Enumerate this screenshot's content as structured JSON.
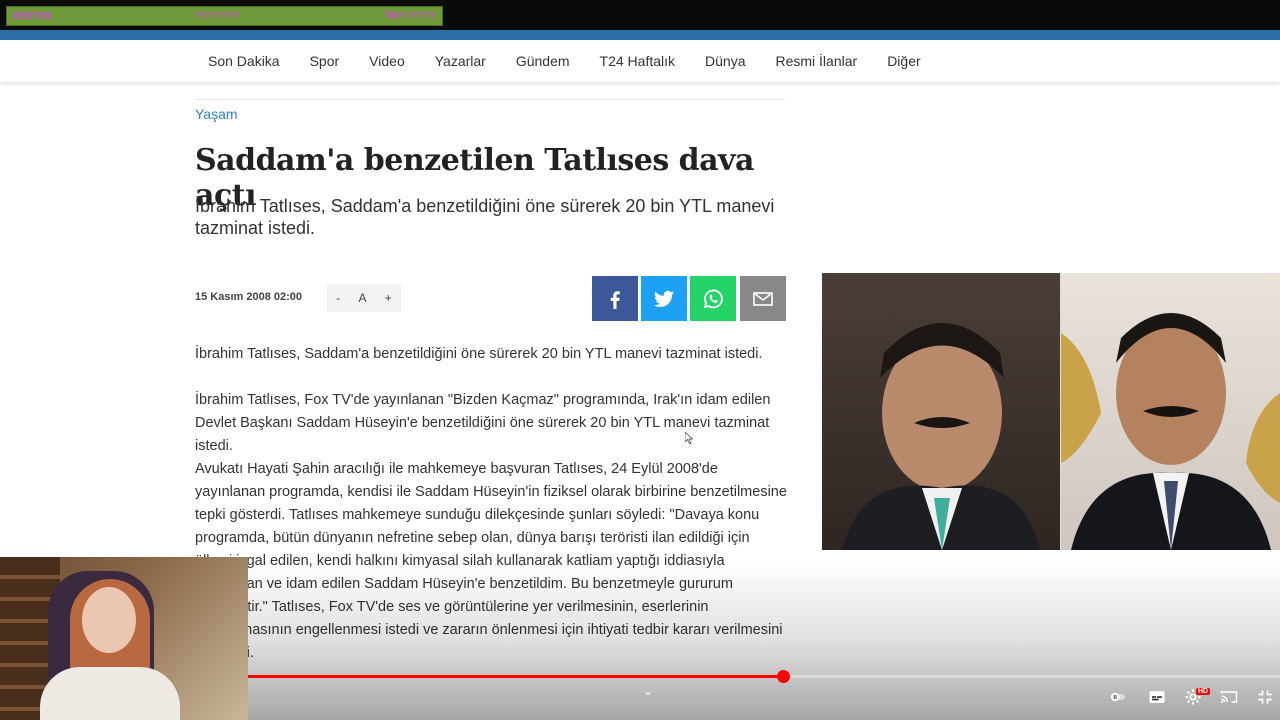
{
  "donation_bar": {
    "left_label": "DEBTEK",
    "mid_label": "???????",
    "right_label": "TRY?????"
  },
  "nav": {
    "items": [
      "Son Dakika",
      "Spor",
      "Video",
      "Yazarlar",
      "Gündem",
      "T24 Haftalık",
      "Dünya",
      "Resmi İlanlar",
      "Diğer"
    ]
  },
  "article": {
    "category": "Yaşam",
    "headline": "Saddam'a benzetilen Tatlıses dava açtı",
    "subhead": "İbrahim Tatlıses, Saddam'a benzetildiğini öne sürerek 20 bin YTL manevi tazminat istedi.",
    "date": "15 Kasım 2008 02:00",
    "font_controls": {
      "decrease": "-",
      "label": "A",
      "increase": "+"
    },
    "paragraphs": [
      "İbrahim Tatlıses, Saddam'a benzetildiğini öne sürerek 20 bin YTL manevi tazminat istedi.",
      "İbrahim Tatlıses, Fox TV'de yayınlanan \"Bizden Kaçmaz\" programında, Irak'ın idam edilen Devlet Başkanı Saddam Hüseyin'e benzetildiğini öne sürerek 20 bin YTL manevi tazminat istedi.",
      "Avukatı Hayati Şahin aracılığı ile mahkemeye başvuran Tatlıses, 24 Eylül 2008'de yayınlanan programda, kendisi ile Saddam Hüseyin'in fiziksel olarak birbirine benzetilmesine tepki gösterdi. Tatlıses mahkemeye sunduğu dilekçesinde şunları söyledi: \"Davaya konu programda, bütün dünyanın nefretine sebep olan, dünya barışı teröristi ilan edildiği için ülkesi işgal edilen, kendi halkını kimyasal silah kullanarak katliam yaptığı iddiasıyla yargılanan ve idam edilen Saddam Hüseyin'e benzetildim. Bu benzetmeyle gururum incinmiştir.\" Tatlıses, Fox TV'de ses ve görüntülerine yer verilmesinin, eserlerinin kullanılmasının engellenmesi istedi ve zararın önlenmesi için ihtiyati tedbir kararı verilmesini talep etti."
    ]
  },
  "share_icons": [
    "facebook-icon",
    "twitter-icon",
    "whatsapp-icon",
    "email-icon"
  ],
  "player": {
    "progress": 0.518,
    "accent": "#ff0000",
    "hd_badge": "HD"
  }
}
